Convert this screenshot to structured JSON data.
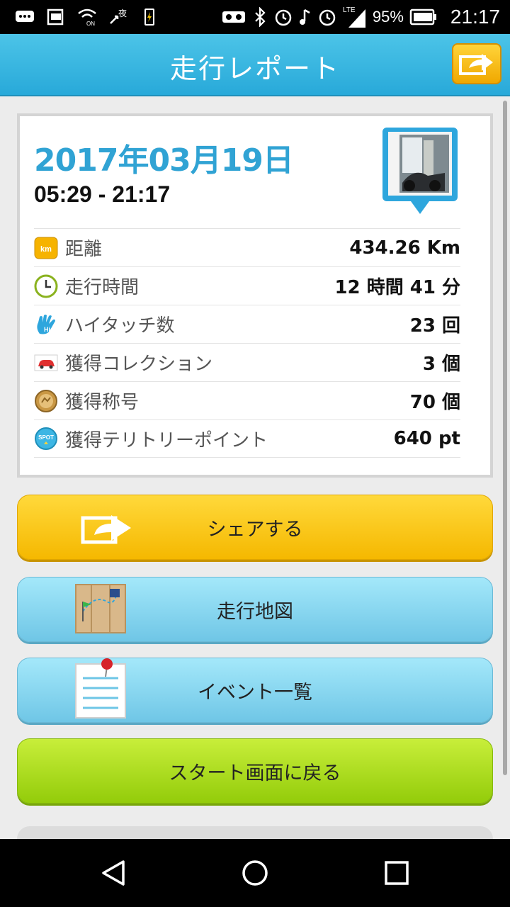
{
  "status_bar": {
    "battery_percent": "95%",
    "time": "21:17",
    "left_icons": [
      "message-icon",
      "photo-icon",
      "wifi-on-icon",
      "night-mode-icon",
      "battery-charging-icon"
    ],
    "right_icons": [
      "vr-icon",
      "bluetooth-icon",
      "alarm-icon",
      "music-icon",
      "alarm-icon",
      "lte-signal-icon",
      "battery-icon"
    ],
    "night_label": "夜",
    "on_label": "ON",
    "lte_label": "LTE"
  },
  "header": {
    "title": "走行レポート",
    "share_icon": "share-arrow-icon"
  },
  "report": {
    "date": "2017年03月19日",
    "time_range": "05:29 - 21:17",
    "stats": [
      {
        "icon": "km-icon",
        "icon_text": "km",
        "label": "距離",
        "value": "434.26 Km"
      },
      {
        "icon": "clock-icon",
        "label": "走行時間",
        "value": "12 時間 41 分"
      },
      {
        "icon": "hightouch-icon",
        "icon_text": "Hi",
        "label": "ハイタッチ数",
        "value": "23 回"
      },
      {
        "icon": "car-icon",
        "label": "獲得コレクション",
        "value": "3 個"
      },
      {
        "icon": "medal-icon",
        "label": "獲得称号",
        "value": "70 個"
      },
      {
        "icon": "spot-icon",
        "icon_text": "SPOT",
        "label": "獲得テリトリーポイント",
        "value": "640 pt"
      }
    ]
  },
  "buttons": {
    "share": "シェアする",
    "map": "走行地図",
    "events": "イベント一覧",
    "start": "スタート画面に戻る"
  },
  "colors": {
    "header": "#28a9d9",
    "date": "#30a3d4",
    "share_button": "#f5b800",
    "blue_button": "#6fc6e6",
    "start_button": "#93cc0a"
  }
}
